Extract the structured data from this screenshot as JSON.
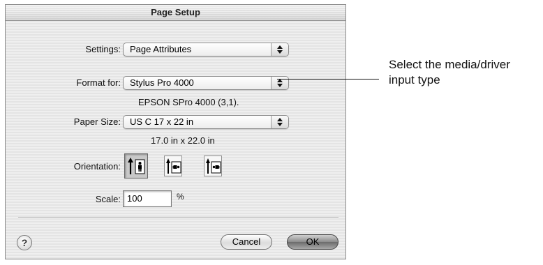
{
  "dialog": {
    "title": "Page Setup",
    "settings": {
      "label": "Settings:",
      "value": "Page Attributes"
    },
    "format_for": {
      "label": "Format for:",
      "value": "Stylus Pro 4000",
      "info": "EPSON SPro 4000 (3,1)."
    },
    "paper_size": {
      "label": "Paper Size:",
      "value": "US C 17 x 22 in",
      "info": "17.0 in x 22.0 in"
    },
    "orientation": {
      "label": "Orientation:",
      "options": [
        {
          "icon": "portrait-orientation-icon",
          "selected": true
        },
        {
          "icon": "landscape-orientation-icon",
          "selected": false
        },
        {
          "icon": "reverse-landscape-orientation-icon",
          "selected": false
        }
      ]
    },
    "scale": {
      "label": "Scale:",
      "value": "100",
      "unit": "%"
    },
    "buttons": {
      "help": "?",
      "cancel": "Cancel",
      "ok": "OK"
    }
  },
  "callout": {
    "line1": "Select the media/driver",
    "line2": "input type"
  }
}
